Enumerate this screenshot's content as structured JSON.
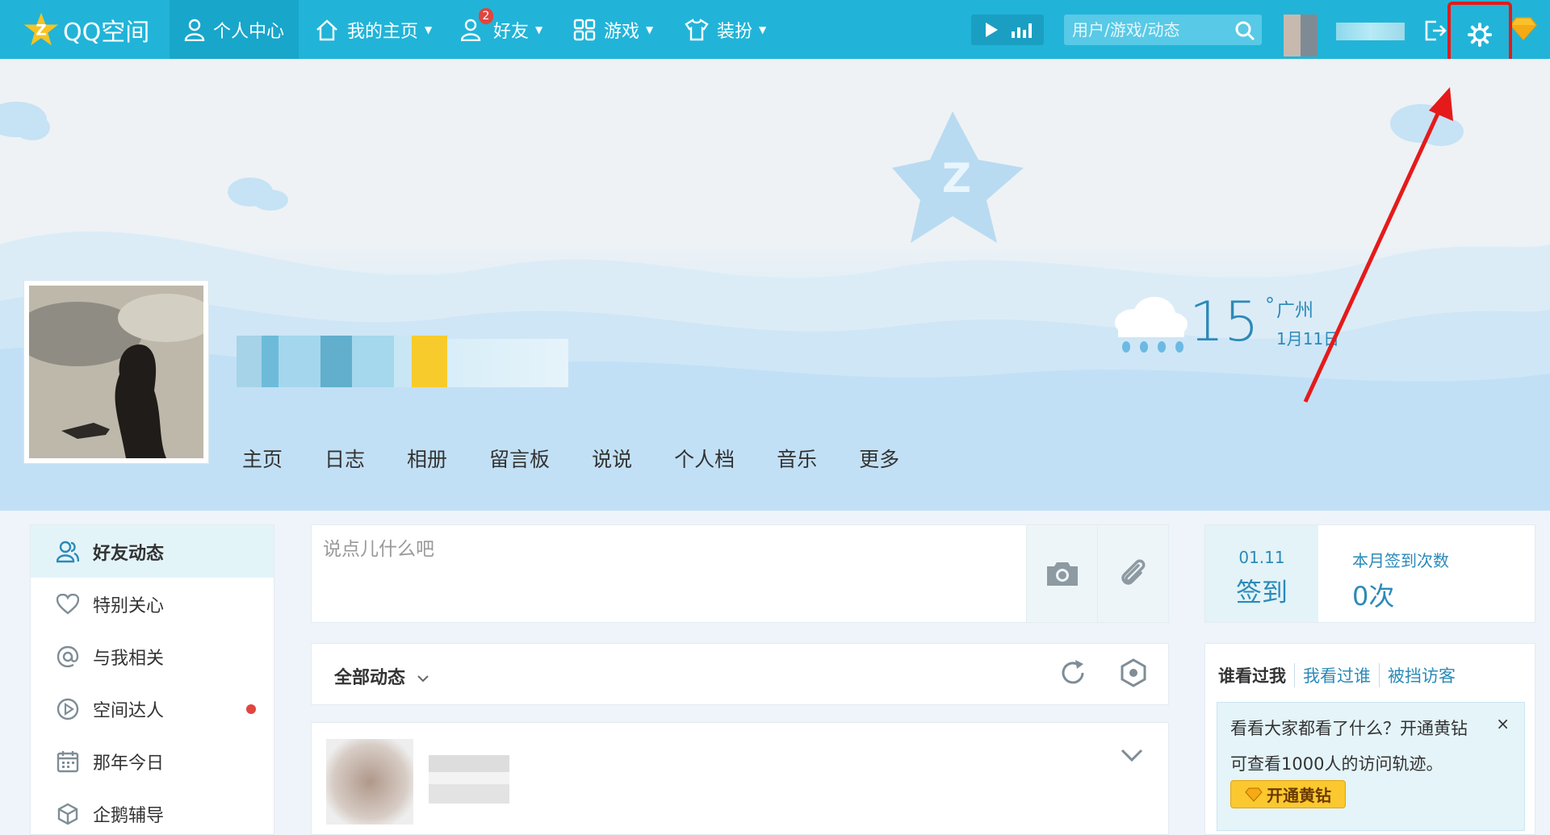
{
  "topbar": {
    "brand": "QQ空间",
    "nav": [
      {
        "label": "个人中心",
        "icon": "person-icon"
      },
      {
        "label": "我的主页",
        "icon": "home-icon"
      },
      {
        "label": "好友",
        "icon": "friends-icon",
        "badge": "2"
      },
      {
        "label": "游戏",
        "icon": "grid-icon"
      },
      {
        "label": "装扮",
        "icon": "shirt-icon"
      }
    ],
    "search_placeholder": "用户/游戏/动态"
  },
  "weather": {
    "temp": "15",
    "deg": "°",
    "city": "广州",
    "date": "1月11日"
  },
  "profile_tabs": [
    "主页",
    "日志",
    "相册",
    "留言板",
    "说说",
    "个人档",
    "音乐",
    "更多"
  ],
  "left_menu": [
    {
      "label": "好友动态",
      "icon": "friends-icon"
    },
    {
      "label": "特别关心",
      "icon": "heart-icon"
    },
    {
      "label": "与我相关",
      "icon": "at-icon"
    },
    {
      "label": "空间达人",
      "icon": "play-circle-icon",
      "dot": true
    },
    {
      "label": "那年今日",
      "icon": "calendar-icon"
    },
    {
      "label": "企鹅辅导",
      "icon": "cube-icon"
    }
  ],
  "post_box": {
    "placeholder": "说点儿什么吧"
  },
  "feed": {
    "title": "全部动态"
  },
  "signin": {
    "date": "01.11",
    "label": "签到",
    "count_title": "本月签到次数",
    "count_value": "0次"
  },
  "visitors": {
    "tabs": [
      "谁看过我",
      "我看过谁",
      "被挡访客"
    ],
    "promo_line1": "看看大家都看了什么？开通黄钻",
    "promo_line2": "可查看1000人的访问轨迹。",
    "promo_button": "开通黄钻",
    "close": "×"
  },
  "colors": {
    "topbar": "#21b4d8",
    "accent": "#2b8ab8",
    "highlight": "#e51a1a"
  }
}
